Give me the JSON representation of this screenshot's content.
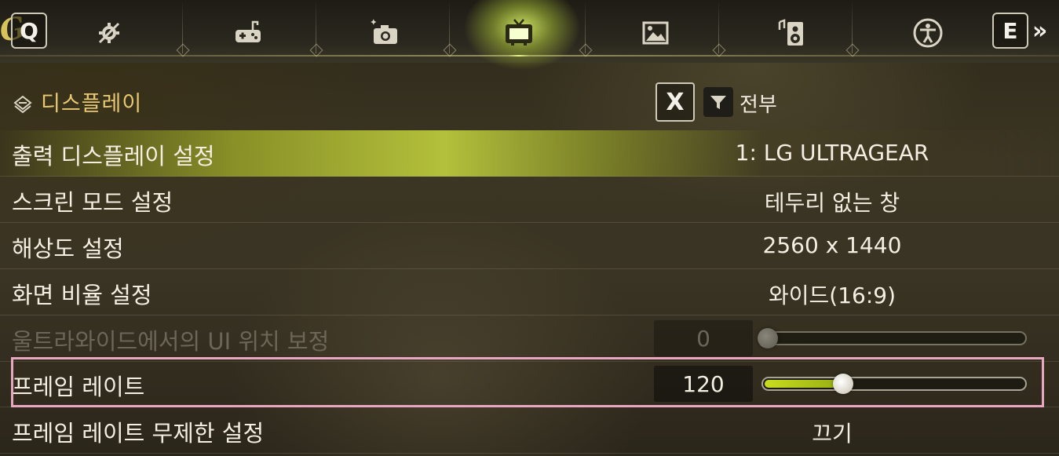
{
  "tabs": {
    "left_key": "Q",
    "right_key": "E",
    "items": [
      {
        "name": "gear-wrench-icon",
        "active": false
      },
      {
        "name": "gamepad-icon",
        "active": false
      },
      {
        "name": "camera-icon",
        "active": false
      },
      {
        "name": "tv-display-icon",
        "active": true
      },
      {
        "name": "image-icon",
        "active": false
      },
      {
        "name": "speaker-icon",
        "active": false
      },
      {
        "name": "accessibility-icon",
        "active": false
      }
    ]
  },
  "header": {
    "section_title": "디스플레이",
    "close_key": "X",
    "filter_label": "전부"
  },
  "settings": [
    {
      "label": "출력 디스플레이 설정",
      "value": "1: LG ULTRAGEAR",
      "selected": true
    },
    {
      "label": "스크린 모드 설정",
      "value": "테두리 없는 창"
    },
    {
      "label": "해상도 설정",
      "value": "2560 x 1440"
    },
    {
      "label": "화면 비율 설정",
      "value": "와이드(16:9)"
    },
    {
      "label": "울트라와이드에서의 UI 위치 보정",
      "value": "0",
      "slider_fraction": 0.0,
      "disabled": true
    },
    {
      "label": "프레임 레이트",
      "value": "120",
      "slider_fraction": 0.29,
      "focused": true
    },
    {
      "label": "프레임 레이트 무제한 설정",
      "value": "끄기"
    }
  ],
  "colors": {
    "accent": "#c8dc1e",
    "section_title": "#e8c872",
    "focus_outline": "#e8a6c0"
  }
}
